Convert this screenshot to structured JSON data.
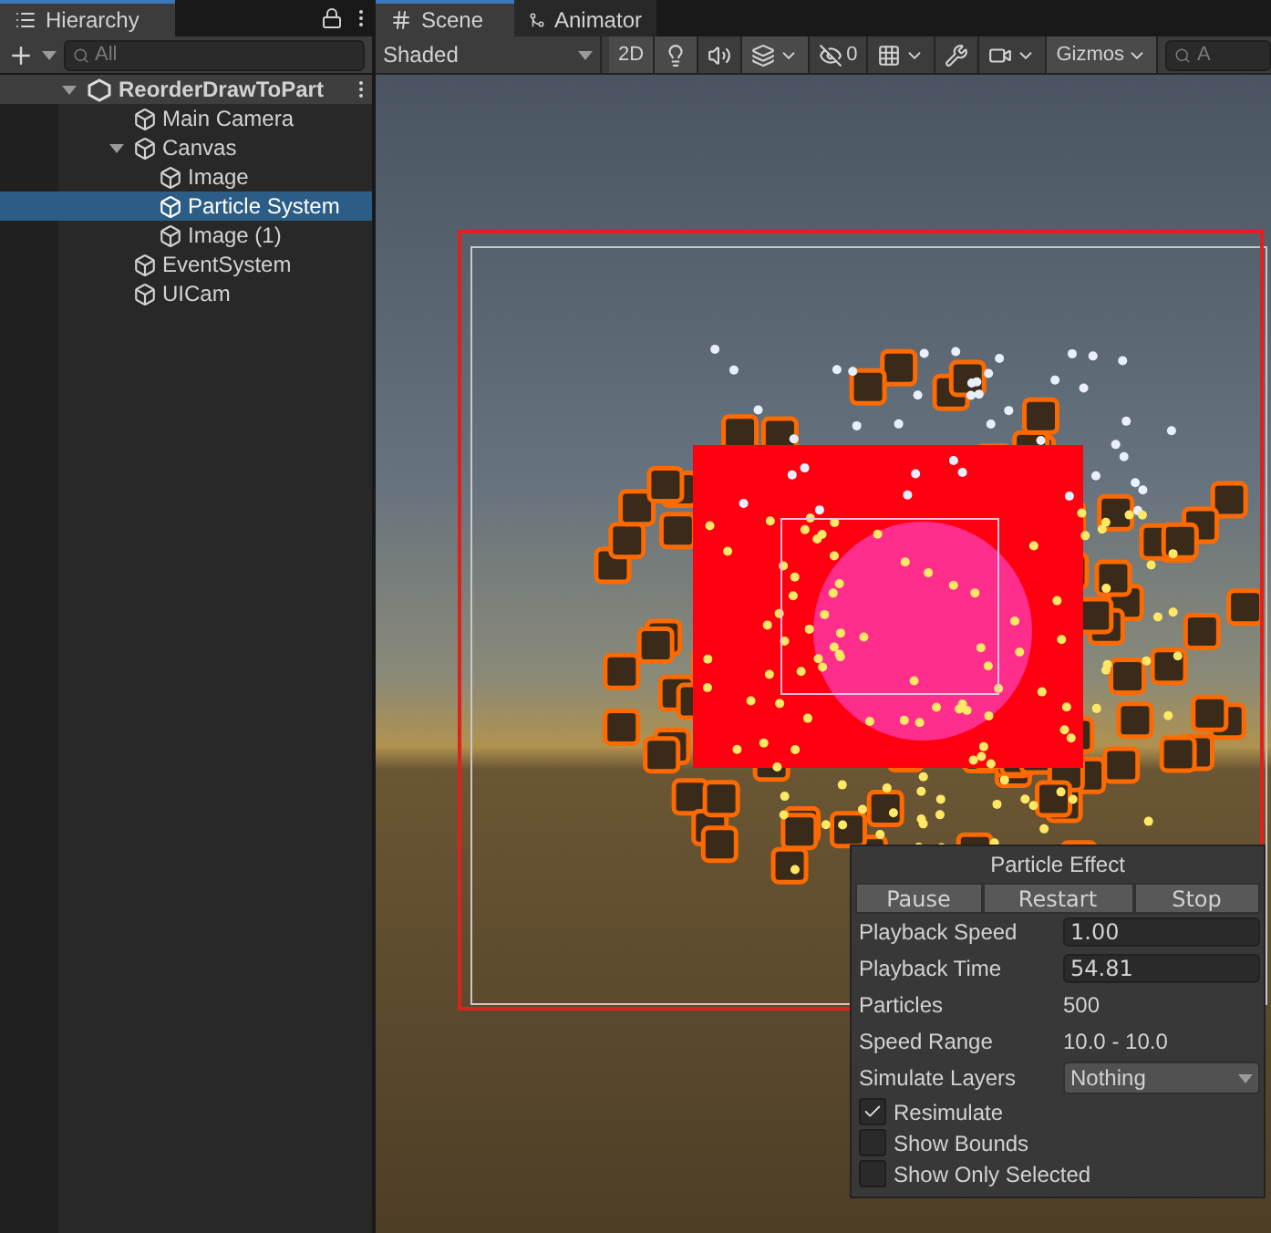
{
  "hierarchy": {
    "tab": "Hierarchy",
    "search": {
      "placeholder": "All"
    },
    "root": {
      "label": "ReorderDrawToPart",
      "expanded": true,
      "children": [
        {
          "label": "Main Camera",
          "selected": false
        },
        {
          "label": "Canvas",
          "selected": false,
          "expanded": true,
          "children": [
            {
              "label": "Image",
              "selected": false
            },
            {
              "label": "Particle System",
              "selected": true
            },
            {
              "label": "Image (1)",
              "selected": false
            }
          ]
        },
        {
          "label": "EventSystem",
          "selected": false
        },
        {
          "label": "UICam",
          "selected": false
        }
      ]
    }
  },
  "scene": {
    "tabs": [
      {
        "label": "Scene",
        "selected": true
      },
      {
        "label": "Animator",
        "selected": false
      }
    ],
    "toolbar": {
      "shading": "Shaded",
      "mode_2d": "2D",
      "hidden_count": "0",
      "gizmos": "Gizmos",
      "search": {
        "placeholder": "A"
      },
      "toggles": [
        {
          "kind": "lighting",
          "on": true
        },
        {
          "kind": "audio",
          "on": false
        },
        {
          "kind": "effects",
          "on": true
        },
        {
          "kind": "visibility",
          "on": false
        },
        {
          "kind": "grid",
          "on": false
        },
        {
          "kind": "tools",
          "on": false
        },
        {
          "kind": "camera",
          "on": false
        }
      ]
    },
    "particle_effect": {
      "title": "Particle Effect",
      "buttons": [
        "Pause",
        "Restart",
        "Stop"
      ],
      "rows": [
        {
          "kind": "input",
          "label": "Playback Speed",
          "value": "1.00"
        },
        {
          "kind": "input",
          "label": "Playback Time",
          "value": "54.81"
        },
        {
          "kind": "text",
          "label": "Particles",
          "value": "500"
        },
        {
          "kind": "text",
          "label": "Speed Range",
          "value": "10.0 - 10.0"
        },
        {
          "kind": "dropdown",
          "label": "Simulate Layers",
          "value": "Nothing"
        },
        {
          "kind": "checkbox",
          "label": "Resimulate",
          "checked": true
        },
        {
          "kind": "checkbox",
          "label": "Show Bounds",
          "checked": false
        },
        {
          "kind": "checkbox",
          "label": "Show Only Selected",
          "checked": false
        }
      ]
    }
  }
}
